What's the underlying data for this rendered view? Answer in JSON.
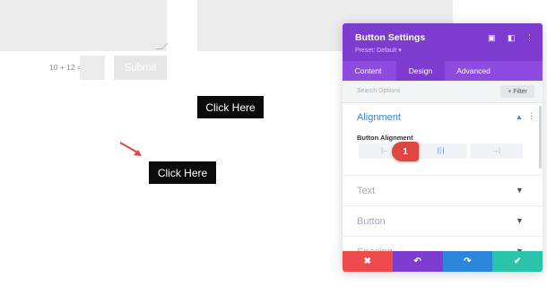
{
  "canvas": {
    "captcha_label": "10 + 12 =",
    "captcha_value": "",
    "submit_label": "Submit",
    "button_top_label": "Click Here",
    "button_bottom_label": "Click Here"
  },
  "panel": {
    "title": "Button Settings",
    "preset": "Preset: Default ▾",
    "header_icons": [
      "fullscreen-icon",
      "columns-icon",
      "more-icon"
    ],
    "tabs": [
      {
        "label": "Content",
        "active": false
      },
      {
        "label": "Design",
        "active": true
      },
      {
        "label": "Advanced",
        "active": false
      }
    ],
    "search_placeholder": "Search Options",
    "filter_label": "+ Filter",
    "alignment": {
      "title": "Alignment",
      "field_label": "Button Alignment",
      "options": [
        {
          "glyph": "|←",
          "name": "left"
        },
        {
          "glyph": "|│|",
          "name": "center"
        },
        {
          "glyph": "→|",
          "name": "right"
        }
      ],
      "selected": "center"
    },
    "collapsed_sections": [
      "Text",
      "Button",
      "Spacing"
    ],
    "footer_buttons": [
      {
        "name": "cancel",
        "glyph": "✖",
        "color": "#ef4b4b"
      },
      {
        "name": "undo",
        "glyph": "↶",
        "color": "#7e3bd0"
      },
      {
        "name": "redo",
        "glyph": "↷",
        "color": "#2b87da"
      },
      {
        "name": "save",
        "glyph": "✔",
        "color": "#29c4a9"
      }
    ]
  },
  "annotation": {
    "step_number": "1",
    "color": "#e0463f"
  },
  "colors": {
    "accent_purple": "#7e3bd0",
    "tab_purple": "#8e4be0",
    "alignment_blue": "#2b87da",
    "button_black": "#0a0a0a",
    "arrow_red": "#e0463f"
  }
}
